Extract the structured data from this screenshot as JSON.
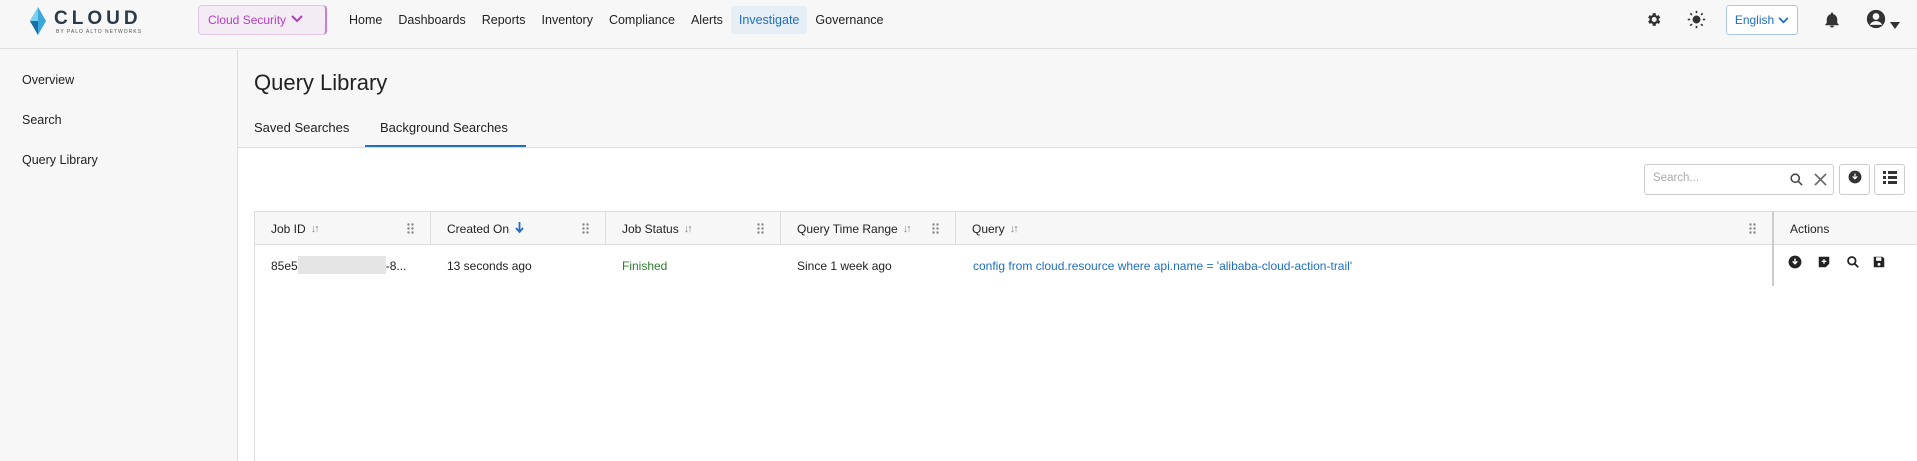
{
  "brand": {
    "name": "CLOUD",
    "tagline": "BY PALO ALTO NETWORKS"
  },
  "product_switcher": {
    "label": "Cloud Security"
  },
  "nav": [
    "Home",
    "Dashboards",
    "Reports",
    "Inventory",
    "Compliance",
    "Alerts",
    "Investigate",
    "Governance"
  ],
  "nav_active": "Investigate",
  "language": {
    "label": "English"
  },
  "sidebar": {
    "items": [
      "Overview",
      "Search",
      "Query Library"
    ]
  },
  "page": {
    "title": "Query Library"
  },
  "tabs": [
    {
      "label": "Saved Searches"
    },
    {
      "label": "Background Searches",
      "active": true
    }
  ],
  "search": {
    "placeholder": "Search..."
  },
  "table": {
    "columns": [
      "Job ID",
      "Created On",
      "Job Status",
      "Query Time Range",
      "Query",
      "Actions"
    ],
    "rows": [
      {
        "job_id_prefix": "85e5",
        "job_id_suffix": "-8...",
        "created_on": "13 seconds ago",
        "status": "Finished",
        "time_range": "Since 1 week ago",
        "query": "config from cloud.resource where api.name = 'alibaba-cloud-action-trail'"
      }
    ]
  },
  "colors": {
    "accent": "#1f6fc1",
    "product": "#b03fbf",
    "status_finished": "#2e7d32"
  }
}
